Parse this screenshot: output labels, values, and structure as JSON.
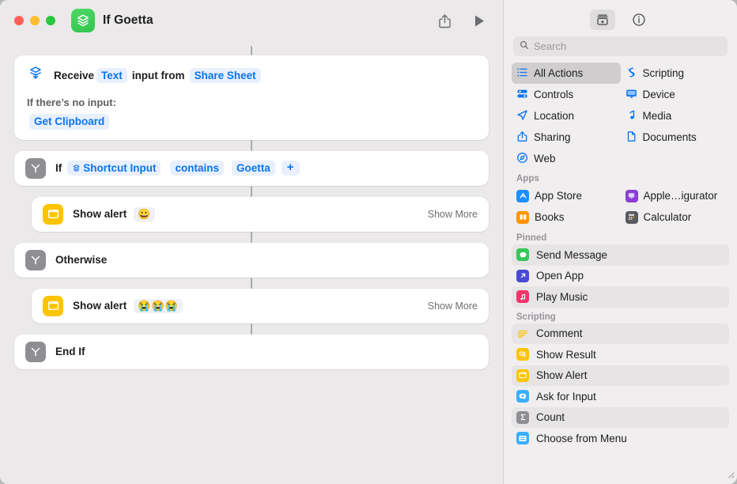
{
  "window": {
    "title": "If Goetta",
    "app_icon_name": "shortcuts-app-icon",
    "traffic_lights": [
      "close",
      "minimize",
      "zoom"
    ],
    "share_label": "Share",
    "play_label": "Play"
  },
  "flow": {
    "receive": {
      "prefix": "Receive",
      "input_type": "Text",
      "middle": "input from",
      "source": "Share Sheet",
      "no_input_label": "If there’s no input:",
      "no_input_value": "Get Clipboard"
    },
    "if_row": {
      "keyword": "If",
      "variable": "Shortcut Input",
      "condition": "contains",
      "value": "Goetta",
      "add_label": "+"
    },
    "alert_true": {
      "label": "Show alert",
      "emoji": "😀",
      "show_more": "Show More"
    },
    "otherwise": {
      "label": "Otherwise"
    },
    "alert_false": {
      "label": "Show alert",
      "emoji": "😭😭😭",
      "show_more": "Show More"
    },
    "end_if": {
      "label": "End If"
    }
  },
  "sidebar": {
    "toolbar": {
      "library_label": "Action Library",
      "info_label": "Shortcut Details"
    },
    "search": {
      "placeholder": "Search",
      "value": ""
    },
    "categories": [
      {
        "label": "All Actions",
        "icon": "list-icon",
        "selected": true
      },
      {
        "label": "Scripting",
        "icon": "scripting-icon",
        "selected": false
      },
      {
        "label": "Controls",
        "icon": "controls-icon",
        "selected": false
      },
      {
        "label": "Device",
        "icon": "display-icon",
        "selected": false
      },
      {
        "label": "Location",
        "icon": "location-arrow-icon",
        "selected": false
      },
      {
        "label": "Media",
        "icon": "music-note-icon",
        "selected": false
      },
      {
        "label": "Sharing",
        "icon": "share-icon",
        "selected": false
      },
      {
        "label": "Documents",
        "icon": "document-icon",
        "selected": false
      },
      {
        "label": "Web",
        "icon": "compass-icon",
        "selected": false
      }
    ],
    "apps": {
      "header": "Apps",
      "items": [
        {
          "label": "App Store",
          "color": "#1e8fff"
        },
        {
          "label": "Apple…igurator",
          "color": "#8a3fd1"
        },
        {
          "label": "Books",
          "color": "#ff9500"
        },
        {
          "label": "Calculator",
          "color": "#5a5a5f"
        }
      ]
    },
    "pinned": {
      "header": "Pinned",
      "items": [
        {
          "label": "Send Message",
          "color": "#34c759",
          "icon": "message-bubble-icon"
        },
        {
          "label": "Open App",
          "color": "#4a49d6",
          "icon": "arrow-up-right-icon"
        },
        {
          "label": "Play Music",
          "color": "#f4346a",
          "icon": "music-note-icon"
        }
      ]
    },
    "scripting": {
      "header": "Scripting",
      "items": [
        {
          "label": "Comment",
          "color": "#ffc400",
          "icon": "comment-lines-icon"
        },
        {
          "label": "Show Result",
          "color": "#ffc400",
          "icon": "show-result-icon"
        },
        {
          "label": "Show Alert",
          "color": "#ffc400",
          "icon": "alert-window-icon"
        },
        {
          "label": "Ask for Input",
          "color": "#3aaeff",
          "icon": "ask-input-icon"
        },
        {
          "label": "Count",
          "color": "#8e8e93",
          "icon": "sigma-icon"
        },
        {
          "label": "Choose from Menu",
          "color": "#3aaeff",
          "icon": "menu-icon"
        }
      ]
    }
  },
  "colors": {
    "accent_blue": "#0a74f0",
    "token_bg": "#e8f0fe",
    "alert_yellow": "#ffc400",
    "control_gray": "#8e8e93",
    "app_green": "#34c44f"
  }
}
